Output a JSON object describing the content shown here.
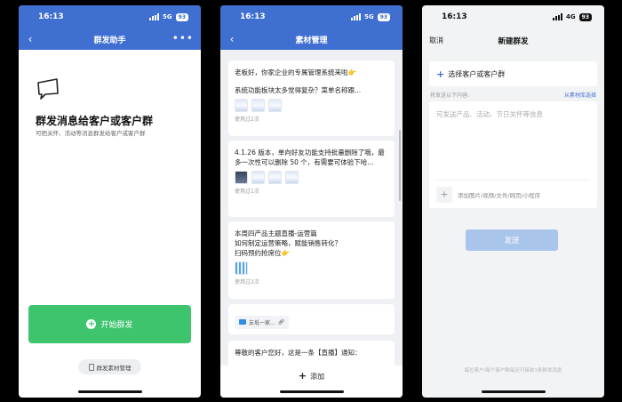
{
  "status": {
    "time": "16:13",
    "network_blue": "5G",
    "network_light": "4G",
    "battery": "93"
  },
  "screen1": {
    "title": "群发助手",
    "more_icon": "more-icon",
    "heading": "群发消息给客户或客户群",
    "subtitle": "可把关怀、活动等消息群发给客户或客户群",
    "start_button": "开始群发",
    "manage_button": "群发素材管理"
  },
  "screen2": {
    "title": "素材管理",
    "cards": [
      {
        "text": "老板好，你家企业的专属管理系统来啦👉",
        "text2": "系统功能板块太多觉得复杂？菜单名称跟...",
        "used": "使用过2次"
      },
      {
        "text": "4.1.26 版本，单向好友功能支持批量删除了哦，最多一次性可以删除 50 个，有需要可体验下哈...",
        "used": "使用过1次"
      },
      {
        "text": "本周四产品主题直播-运营篇",
        "text2": "如何制定运营策略，赋能销售转化？",
        "text3": "扫码预约抢席位👉",
        "used": "使用过2次"
      },
      {
        "link": "友坻一家..."
      },
      {
        "text": "尊敬的客户您好，这是一条【直播】通知："
      }
    ],
    "add_button": "添加"
  },
  "screen3": {
    "cancel": "取消",
    "title": "新建群发",
    "select_customers": "选择客户或客户群",
    "send_label": "将发送以下内容:",
    "from_library": "从素材库选择",
    "placeholder": "可发送产品、活动、节日关怀等信息",
    "attach_label": "添加图片/视频/文件/网页/小程序",
    "send_button": "发送",
    "footnote": "每位客户/每个客户群每天可接收1条群发消息"
  },
  "colors": {
    "primary_blue": "#3f6fd1",
    "green": "#3dc46d",
    "send_disabled": "#a9c5ec"
  }
}
